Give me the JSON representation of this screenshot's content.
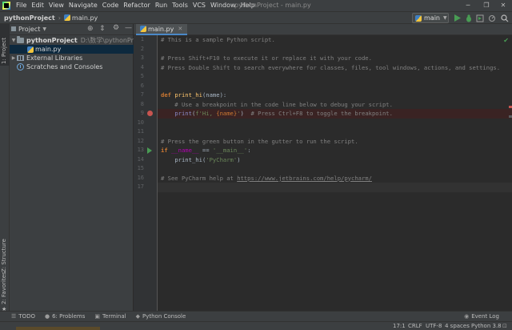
{
  "menu": [
    "File",
    "Edit",
    "View",
    "Navigate",
    "Code",
    "Refactor",
    "Run",
    "Tools",
    "VCS",
    "Window",
    "Help"
  ],
  "window_title": "pythonProject - main.py",
  "window_controls": {
    "minimize": "─",
    "maximize": "❐",
    "close": "✕"
  },
  "navbar": {
    "project": "pythonProject",
    "file": "main.py",
    "run_config": "main"
  },
  "left_stripe": {
    "project": "1: Project",
    "structure": "Z: Structure",
    "favorites": "2: Favorites"
  },
  "project_panel": {
    "title": "Project",
    "tree": {
      "root_name": "pythonProject",
      "root_path": "D:\\数学\\pythonProject",
      "file": "main.py",
      "libraries": "External Libraries",
      "scratches": "Scratches and Consoles"
    }
  },
  "editor": {
    "tab": "main.py",
    "line_numbers": [
      "1",
      "2",
      "3",
      "4",
      "5",
      "6",
      "7",
      "8",
      "9",
      "10",
      "11",
      "12",
      "13",
      "14",
      "15",
      "16",
      "17"
    ],
    "lines": {
      "l1": "# This is a sample Python script.",
      "l3": "# Press Shift+F10 to execute it or replace it with your code.",
      "l4": "# Press Double Shift to search everywhere for classes, files, tool windows, actions, and settings.",
      "l7_kw": "def",
      "l7_fn": "print_hi",
      "l7_rest": "(name):",
      "l8": "    # Use a breakpoint in the code line below to debug your script.",
      "l9_fn": "print",
      "l9_open": "(",
      "l9_str1": "f'Hi, ",
      "l9_fmt": "{name}",
      "l9_str2": "'",
      "l9_close": ")",
      "l9_comment": "  # Press Ctrl+F8 to toggle the breakpoint.",
      "l12": "# Press the green button in the gutter to run the script.",
      "l13_kw": "if",
      "l13_name": " __name__",
      "l13_op": " == ",
      "l13_str": "'__main__'",
      "l13_colon": ":",
      "l14_fn": "print_hi",
      "l14_open": "(",
      "l14_str": "'PyCharm'",
      "l14_close": ")",
      "l16_comment": "# See PyCharm help at ",
      "l16_link": "https://www.jetbrains.com/help/pycharm/"
    }
  },
  "bottom_tools": {
    "todo": "TODO",
    "problems": "6: Problems",
    "terminal": "Terminal",
    "python_console": "Python Console",
    "event_log": "Event Log"
  },
  "status": {
    "position": "17:1",
    "line_sep": "CRLF",
    "encoding": "UTF-8",
    "indent": "4 spaces",
    "interpreter": "Python 3.8"
  },
  "colors": {
    "accent": "#4a88c7",
    "breakpoint": "#c75450",
    "run": "#499c54"
  }
}
